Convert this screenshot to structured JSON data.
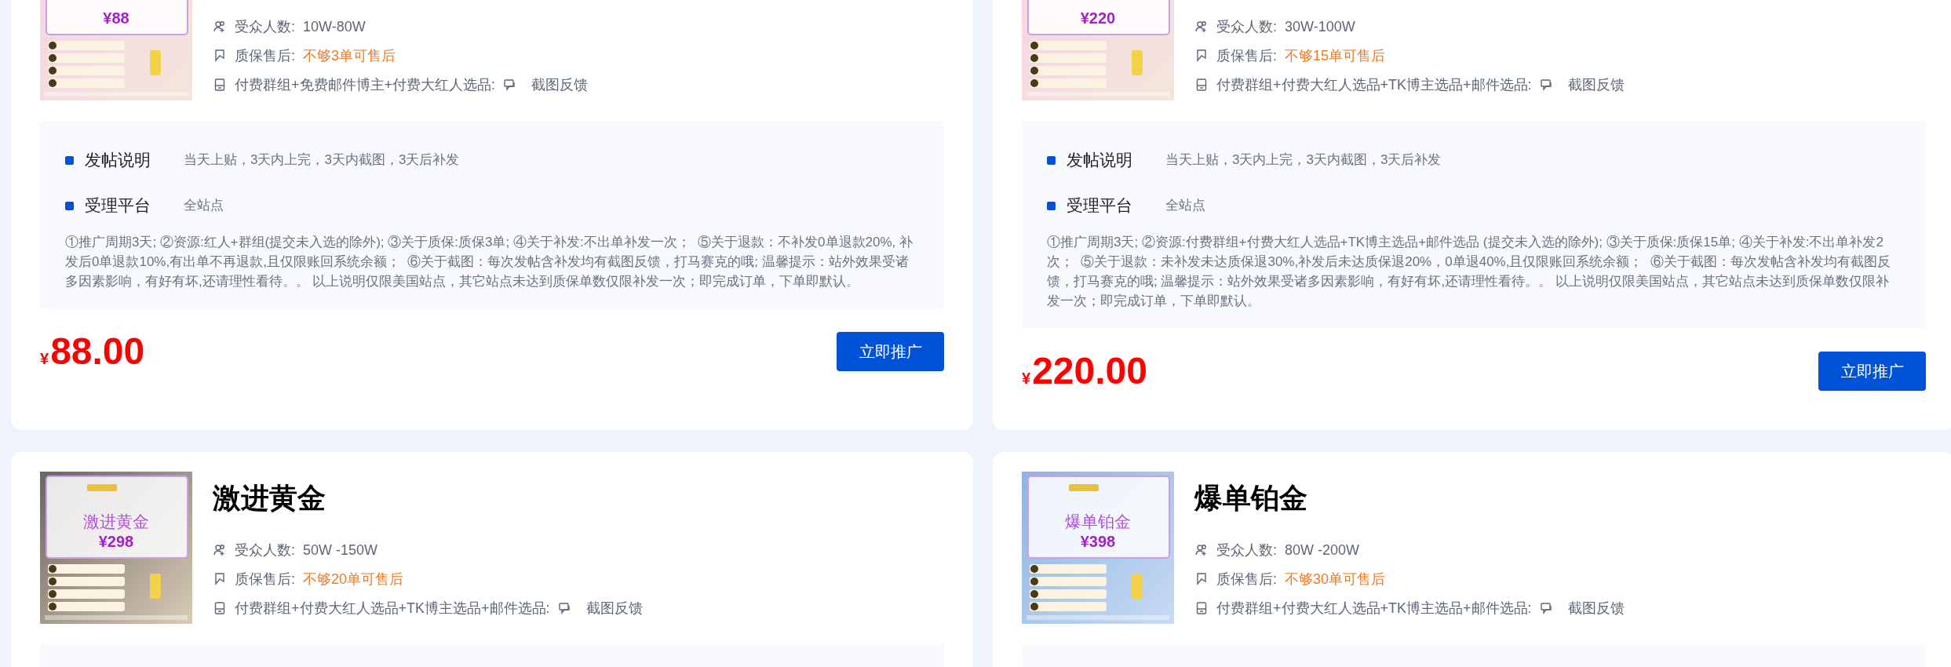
{
  "cards": [
    {
      "image": {
        "kind": "pink",
        "price": "¥88"
      },
      "audience_label": "受众人数:",
      "audience": "10W-80W",
      "warranty_label": "质保售后:",
      "warranty": "不够3单可售后",
      "resources": "付费群组+免费邮件博主+付费大红人选品:",
      "feedback": "截图反馈",
      "details": {
        "rows": [
          {
            "label": "发帖说明",
            "value": "当天上贴，3天内上完，3天内截图，3天后补发"
          },
          {
            "label": "受理平台",
            "value": "全站点"
          }
        ],
        "notes": "①推广周期3天; ②资源:红人+群组(提交未入选的除外); ③关于质保:质保3单; ④关于补发:不出单补发一次；  ⑤关于退款：不补发0单退款20%, 补发后0单退款10%,有出单不再退款,且仅限账回系统余额；  ⑥关于截图：每次发帖含补发均有截图反馈，打马赛克的哦; 温馨提示：站外效果受诸多因素影响，有好有坏,还请理性看待。。 以上说明仅限美国站点，其它站点未达到质保单数仅限补发一次；即完成订单，下单即默认。"
      },
      "price": {
        "currency": "¥",
        "amount": "88.00"
      },
      "button": "立即推广"
    },
    {
      "image": {
        "kind": "pink",
        "price": "¥220"
      },
      "audience_label": "受众人数:",
      "audience": "30W-100W",
      "warranty_label": "质保售后:",
      "warranty": "不够15单可售后",
      "resources": "付费群组+付费大红人选品+TK博主选品+邮件选品:",
      "feedback": "截图反馈",
      "details": {
        "rows": [
          {
            "label": "发帖说明",
            "value": "当天上贴，3天内上完，3天内截图，3天后补发"
          },
          {
            "label": "受理平台",
            "value": "全站点"
          }
        ],
        "notes": "①推广周期3天; ②资源:付费群组+付费大红人选品+TK博主选品+邮件选品 (提交未入选的除外); ③关于质保:质保15单; ④关于补发:不出单补发2次；  ⑤关于退款：未补发未达质保退30%,补发后未达质保退20%，0单退40%,且仅限账回系统余额；  ⑥关于截图：每次发帖含补发均有截图反馈，打马赛克的哦; 温馨提示：站外效果受诸多因素影响，有好有坏,还请理性看待。。 以上说明仅限美国站点，其它站点未达到质保单数仅限补发一次；即完成订单，下单即默认。"
      },
      "price": {
        "currency": "¥",
        "amount": "220.00"
      },
      "button": "立即推广"
    },
    {
      "image": {
        "kind": "beige",
        "title": "激进黄金",
        "price": "¥298"
      },
      "title": "激进黄金",
      "audience_label": "受众人数:",
      "audience": "50W -150W",
      "warranty_label": "质保售后:",
      "warranty": "不够20单可售后",
      "resources": "付费群组+付费大红人选品+TK博主选品+邮件选品:",
      "feedback": "截图反馈"
    },
    {
      "image": {
        "kind": "sky",
        "title": "爆单铂金",
        "price": "¥398"
      },
      "title": "爆单铂金",
      "audience_label": "受众人数:",
      "audience": "80W -200W",
      "warranty_label": "质保售后:",
      "warranty": "不够30单可售后",
      "resources": "付费群组+付费大红人选品+TK博主选品+邮件选品:",
      "feedback": "截图反馈"
    }
  ]
}
